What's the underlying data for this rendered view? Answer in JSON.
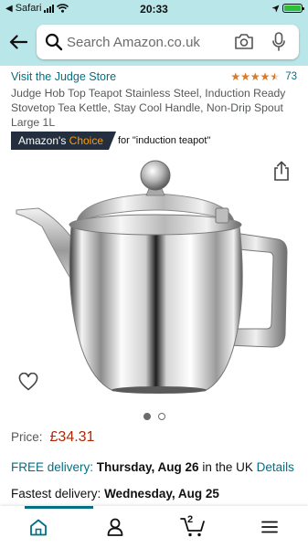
{
  "status_bar": {
    "carrier": "Safari",
    "time": "20:33"
  },
  "header": {
    "search": {
      "placeholder": "Search Amazon.co.uk"
    }
  },
  "product": {
    "store_link": "Visit the Judge Store",
    "rating": {
      "stars": 4.5,
      "max": 5,
      "count": "73"
    },
    "title": "Judge Hob Top Teapot Stainless Steel, Induction Ready Stovetop Tea Kettle, Stay Cool Handle, Non-Drip Spout Large 1L",
    "badge": {
      "prefix": "Amazon's",
      "accent": "Choice",
      "for_text": "for \"induction teapot\""
    },
    "image_carousel": {
      "current": 1,
      "total": 2
    },
    "price": {
      "label": "Price:",
      "value": "£34.31"
    },
    "delivery": {
      "free_label": "FREE delivery:",
      "date": "Thursday, Aug 26",
      "region": "in the UK",
      "details_link": "Details"
    },
    "fastest": {
      "label": "Fastest delivery:",
      "date": "Wednesday, Aug 25"
    }
  },
  "bottom_nav": {
    "active": "home",
    "cart_count": "2",
    "items": [
      "home",
      "account",
      "cart",
      "menu"
    ]
  },
  "colors": {
    "header_bg": "#b9e6e8",
    "link": "#007185",
    "price": "#b12704",
    "star": "#de7921",
    "badge_bg": "#232f3e",
    "badge_accent": "#ff9900"
  }
}
